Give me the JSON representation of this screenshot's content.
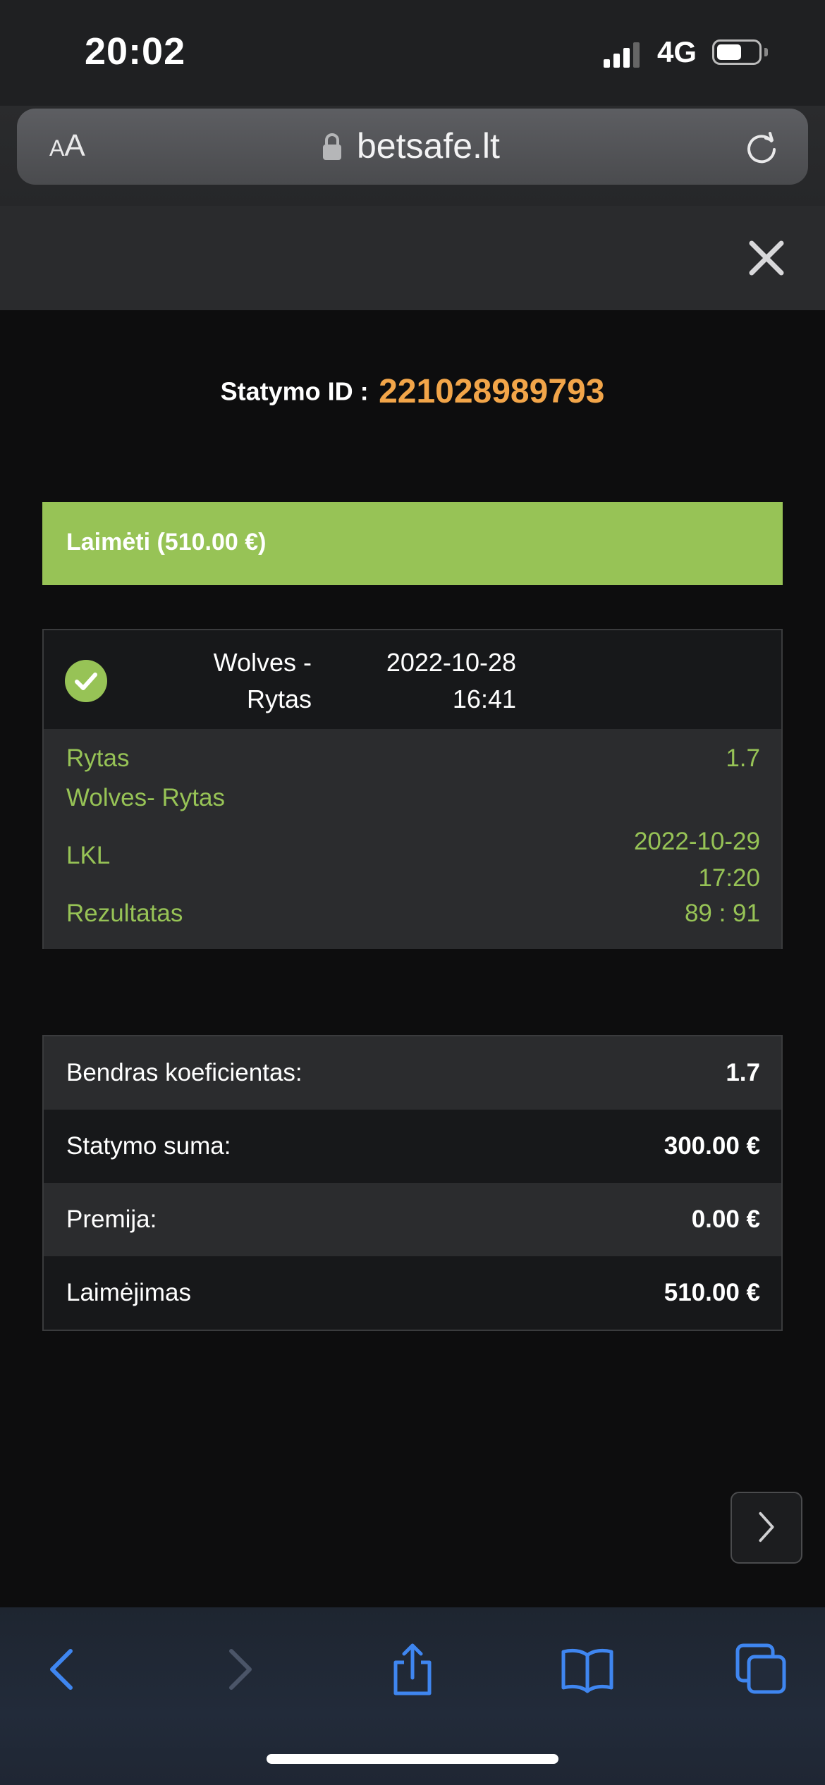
{
  "status_bar": {
    "time": "20:02",
    "network": "4G"
  },
  "browser": {
    "domain": "betsafe.lt",
    "text_size_label": "AA"
  },
  "bet": {
    "id_label": "Statymo ID :",
    "id_value": "221028989793",
    "status": "Laimėti (510.00 €)"
  },
  "event": {
    "teams_line1": "Wolves -",
    "teams_line2": "Rytas",
    "date": "2022-10-28",
    "time": "16:41",
    "selection": "Rytas",
    "odds": "1.7",
    "match": "Wolves- Rytas",
    "league": "LKL",
    "match_date": "2022-10-29",
    "match_time": "17:20",
    "result_label": "Rezultatas",
    "result_value": "89 : 91"
  },
  "summary": [
    {
      "label": "Bendras koeficientas:",
      "value": "1.7"
    },
    {
      "label": "Statymo suma:",
      "value": "300.00 €"
    },
    {
      "label": "Premija:",
      "value": "0.00 €"
    },
    {
      "label": "Laimėjimas",
      "value": "510.00 €"
    }
  ],
  "colors": {
    "accent_orange": "#f2a549",
    "win_green": "#97c356",
    "toolbar_blue": "#3f86f0"
  }
}
